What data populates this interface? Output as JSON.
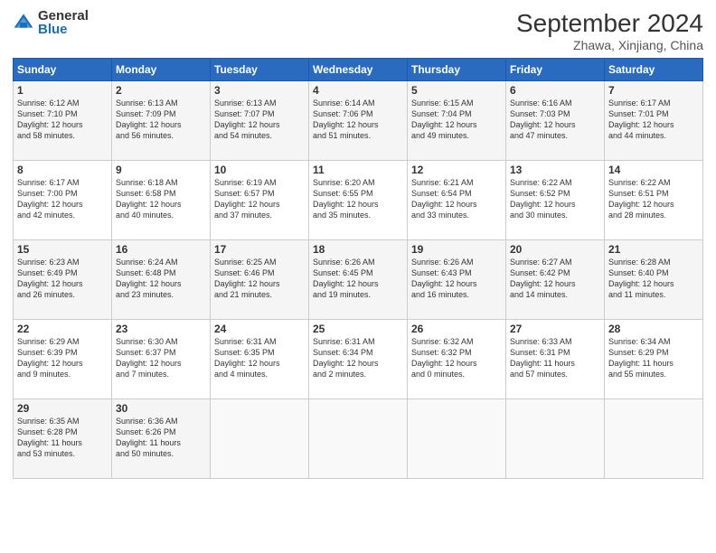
{
  "header": {
    "logo_general": "General",
    "logo_blue": "Blue",
    "month_title": "September 2024",
    "location": "Zhawa, Xinjiang, China"
  },
  "weekdays": [
    "Sunday",
    "Monday",
    "Tuesday",
    "Wednesday",
    "Thursday",
    "Friday",
    "Saturday"
  ],
  "weeks": [
    [
      {
        "day": "1",
        "info": "Sunrise: 6:12 AM\nSunset: 7:10 PM\nDaylight: 12 hours\nand 58 minutes."
      },
      {
        "day": "2",
        "info": "Sunrise: 6:13 AM\nSunset: 7:09 PM\nDaylight: 12 hours\nand 56 minutes."
      },
      {
        "day": "3",
        "info": "Sunrise: 6:13 AM\nSunset: 7:07 PM\nDaylight: 12 hours\nand 54 minutes."
      },
      {
        "day": "4",
        "info": "Sunrise: 6:14 AM\nSunset: 7:06 PM\nDaylight: 12 hours\nand 51 minutes."
      },
      {
        "day": "5",
        "info": "Sunrise: 6:15 AM\nSunset: 7:04 PM\nDaylight: 12 hours\nand 49 minutes."
      },
      {
        "day": "6",
        "info": "Sunrise: 6:16 AM\nSunset: 7:03 PM\nDaylight: 12 hours\nand 47 minutes."
      },
      {
        "day": "7",
        "info": "Sunrise: 6:17 AM\nSunset: 7:01 PM\nDaylight: 12 hours\nand 44 minutes."
      }
    ],
    [
      {
        "day": "8",
        "info": "Sunrise: 6:17 AM\nSunset: 7:00 PM\nDaylight: 12 hours\nand 42 minutes."
      },
      {
        "day": "9",
        "info": "Sunrise: 6:18 AM\nSunset: 6:58 PM\nDaylight: 12 hours\nand 40 minutes."
      },
      {
        "day": "10",
        "info": "Sunrise: 6:19 AM\nSunset: 6:57 PM\nDaylight: 12 hours\nand 37 minutes."
      },
      {
        "day": "11",
        "info": "Sunrise: 6:20 AM\nSunset: 6:55 PM\nDaylight: 12 hours\nand 35 minutes."
      },
      {
        "day": "12",
        "info": "Sunrise: 6:21 AM\nSunset: 6:54 PM\nDaylight: 12 hours\nand 33 minutes."
      },
      {
        "day": "13",
        "info": "Sunrise: 6:22 AM\nSunset: 6:52 PM\nDaylight: 12 hours\nand 30 minutes."
      },
      {
        "day": "14",
        "info": "Sunrise: 6:22 AM\nSunset: 6:51 PM\nDaylight: 12 hours\nand 28 minutes."
      }
    ],
    [
      {
        "day": "15",
        "info": "Sunrise: 6:23 AM\nSunset: 6:49 PM\nDaylight: 12 hours\nand 26 minutes."
      },
      {
        "day": "16",
        "info": "Sunrise: 6:24 AM\nSunset: 6:48 PM\nDaylight: 12 hours\nand 23 minutes."
      },
      {
        "day": "17",
        "info": "Sunrise: 6:25 AM\nSunset: 6:46 PM\nDaylight: 12 hours\nand 21 minutes."
      },
      {
        "day": "18",
        "info": "Sunrise: 6:26 AM\nSunset: 6:45 PM\nDaylight: 12 hours\nand 19 minutes."
      },
      {
        "day": "19",
        "info": "Sunrise: 6:26 AM\nSunset: 6:43 PM\nDaylight: 12 hours\nand 16 minutes."
      },
      {
        "day": "20",
        "info": "Sunrise: 6:27 AM\nSunset: 6:42 PM\nDaylight: 12 hours\nand 14 minutes."
      },
      {
        "day": "21",
        "info": "Sunrise: 6:28 AM\nSunset: 6:40 PM\nDaylight: 12 hours\nand 11 minutes."
      }
    ],
    [
      {
        "day": "22",
        "info": "Sunrise: 6:29 AM\nSunset: 6:39 PM\nDaylight: 12 hours\nand 9 minutes."
      },
      {
        "day": "23",
        "info": "Sunrise: 6:30 AM\nSunset: 6:37 PM\nDaylight: 12 hours\nand 7 minutes."
      },
      {
        "day": "24",
        "info": "Sunrise: 6:31 AM\nSunset: 6:35 PM\nDaylight: 12 hours\nand 4 minutes."
      },
      {
        "day": "25",
        "info": "Sunrise: 6:31 AM\nSunset: 6:34 PM\nDaylight: 12 hours\nand 2 minutes."
      },
      {
        "day": "26",
        "info": "Sunrise: 6:32 AM\nSunset: 6:32 PM\nDaylight: 12 hours\nand 0 minutes."
      },
      {
        "day": "27",
        "info": "Sunrise: 6:33 AM\nSunset: 6:31 PM\nDaylight: 11 hours\nand 57 minutes."
      },
      {
        "day": "28",
        "info": "Sunrise: 6:34 AM\nSunset: 6:29 PM\nDaylight: 11 hours\nand 55 minutes."
      }
    ],
    [
      {
        "day": "29",
        "info": "Sunrise: 6:35 AM\nSunset: 6:28 PM\nDaylight: 11 hours\nand 53 minutes."
      },
      {
        "day": "30",
        "info": "Sunrise: 6:36 AM\nSunset: 6:26 PM\nDaylight: 11 hours\nand 50 minutes."
      },
      {
        "day": "",
        "info": ""
      },
      {
        "day": "",
        "info": ""
      },
      {
        "day": "",
        "info": ""
      },
      {
        "day": "",
        "info": ""
      },
      {
        "day": "",
        "info": ""
      }
    ]
  ]
}
